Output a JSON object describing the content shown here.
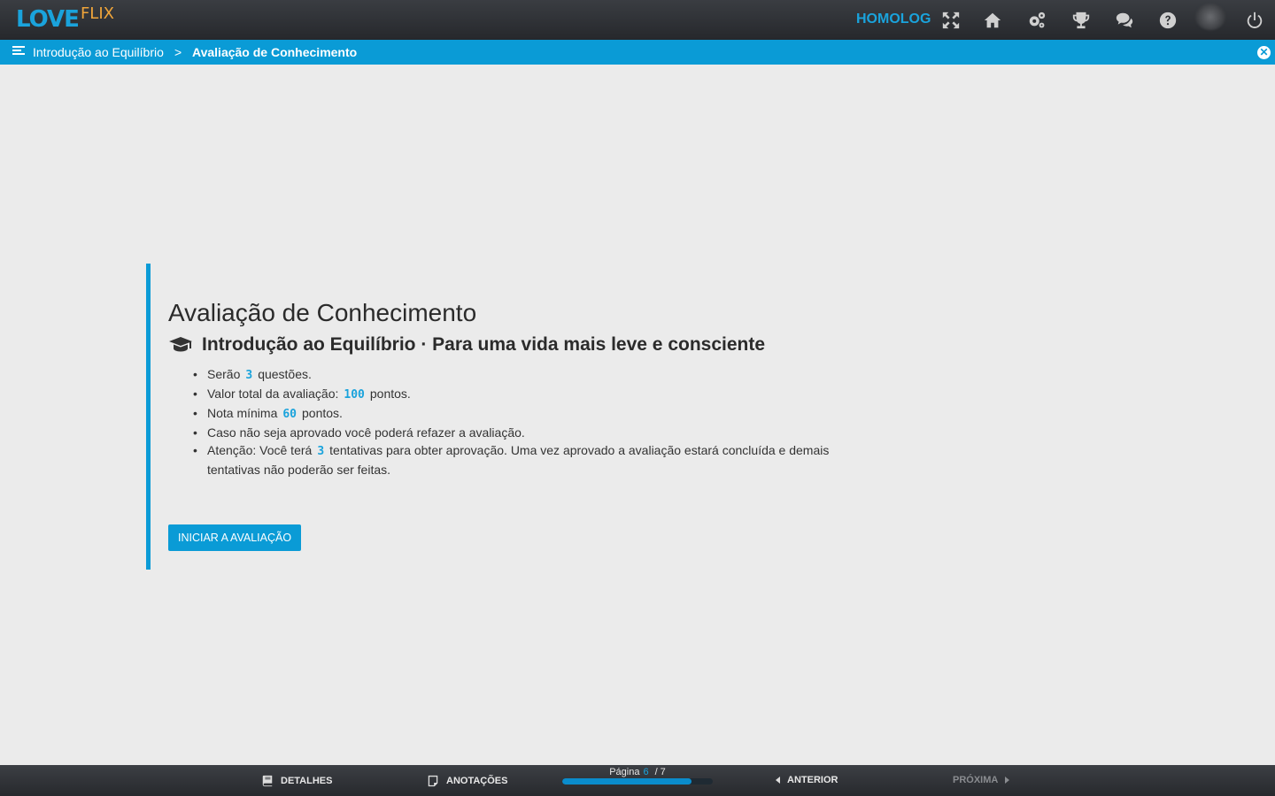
{
  "topbar": {
    "logo_main": "LOVE",
    "logo_sub": "FLIX",
    "environment": "HOMOLOG",
    "icons": [
      "fullscreen-icon",
      "home-icon",
      "settings-icon",
      "trophy-icon",
      "chat-icon",
      "help-icon",
      "power-icon"
    ]
  },
  "breadcrumb": {
    "course": "Introdução ao Equilíbrio",
    "separator": ">",
    "current": "Avaliação de Conhecimento"
  },
  "assessment": {
    "title": "Avaliação de Conhecimento",
    "subtitle": "Introdução ao Equilíbrio · Para uma vida mais leve e consciente",
    "rules": [
      {
        "before": "Serão",
        "value": "3",
        "after": "questões."
      },
      {
        "before": "Valor total da avaliação:",
        "value": "100",
        "after": "pontos."
      },
      {
        "before": "Nota mínima",
        "value": "60",
        "after": "pontos."
      },
      {
        "before": "Caso não seja aprovado você poderá refazer a avaliação.",
        "value": "",
        "after": ""
      },
      {
        "before": "Atenção: Você terá",
        "value": "3",
        "after": "tentativas para obter aprovação. Uma vez aprovado a avaliação estará concluída e demais tentativas não poderão ser feitas."
      }
    ],
    "start_button": "INICIAR A AVALIAÇÃO"
  },
  "bottombar": {
    "details": "DETALHES",
    "notes": "ANOTAÇÕES",
    "page_label": "Página",
    "page_current": "6",
    "page_sep": "/",
    "page_total": "7",
    "progress": 0.857,
    "prev": "ANTERIOR",
    "next": "PRÓXIMA"
  },
  "colors": {
    "accent": "#0a9bd6",
    "logo_orange": "#f0a53a",
    "background": "#ebebeb"
  }
}
